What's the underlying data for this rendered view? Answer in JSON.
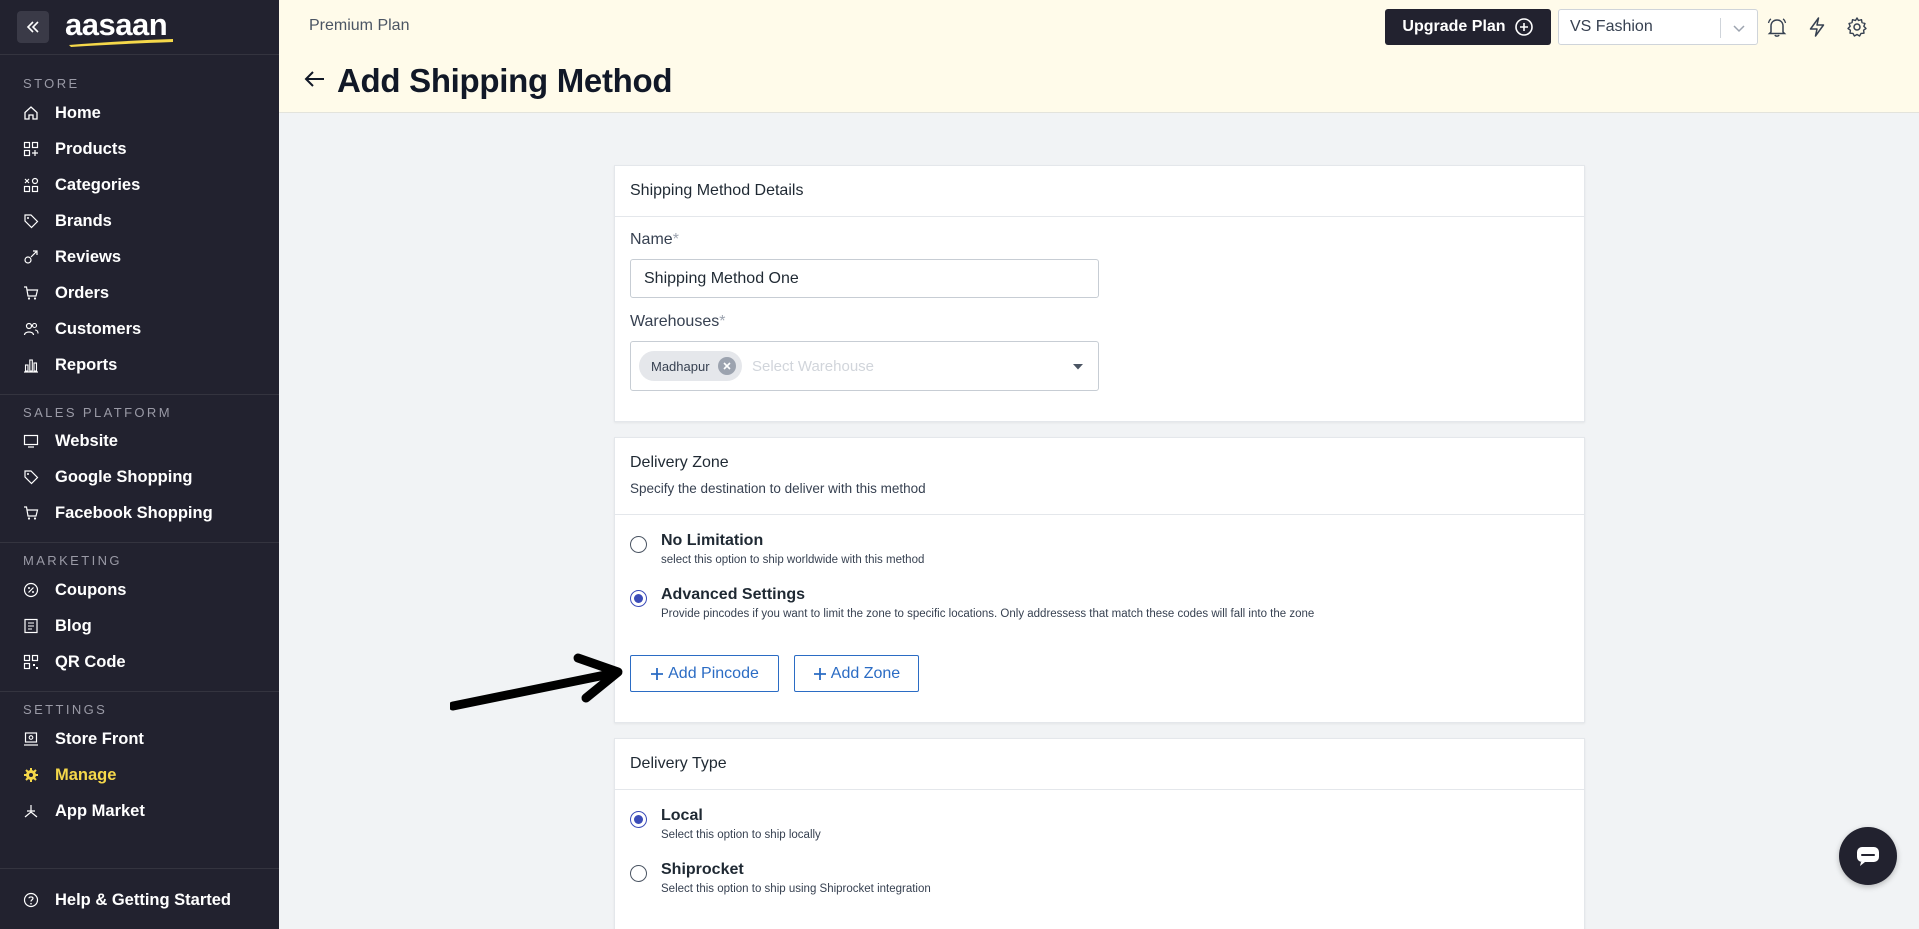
{
  "brand": {
    "logo_text": "aasaan",
    "accent": "#f5d84a",
    "sidebar_bg": "#22222f"
  },
  "sidebar": {
    "sections": {
      "store": "STORE",
      "sales_platform": "SALES PLATFORM",
      "marketing": "MARKETING",
      "settings": "SETTINGS"
    },
    "items": [
      {
        "label": "Home",
        "icon": "home-icon"
      },
      {
        "label": "Products",
        "icon": "grid-icon"
      },
      {
        "label": "Categories",
        "icon": "categories-icon"
      },
      {
        "label": "Brands",
        "icon": "tag-icon"
      },
      {
        "label": "Reviews",
        "icon": "reviews-icon"
      },
      {
        "label": "Orders",
        "icon": "cart-icon"
      },
      {
        "label": "Customers",
        "icon": "users-icon"
      },
      {
        "label": "Reports",
        "icon": "bar-chart-icon"
      },
      {
        "label": "Website",
        "icon": "monitor-icon"
      },
      {
        "label": "Google Shopping",
        "icon": "tag-icon"
      },
      {
        "label": "Facebook Shopping",
        "icon": "cart-icon"
      },
      {
        "label": "Coupons",
        "icon": "coupon-icon"
      },
      {
        "label": "Blog",
        "icon": "blog-icon"
      },
      {
        "label": "QR Code",
        "icon": "qr-code-icon"
      },
      {
        "label": "Store Front",
        "icon": "storefront-icon"
      },
      {
        "label": "Manage",
        "icon": "gear-icon",
        "active": true
      },
      {
        "label": "App Market",
        "icon": "app-market-icon"
      }
    ],
    "help": "Help & Getting Started"
  },
  "header": {
    "plan": "Premium Plan",
    "title": "Add Shipping Method",
    "upgrade_label": "Upgrade Plan",
    "store_name": "VS Fashion"
  },
  "details_card": {
    "title": "Shipping Method Details",
    "name_label": "Name",
    "name_value": "Shipping Method One",
    "warehouses_label": "Warehouses",
    "required_mark": "*",
    "warehouse_chip": "Madhapur",
    "warehouse_placeholder": "Select Warehouse"
  },
  "delivery_zone": {
    "title": "Delivery Zone",
    "subtitle": "Specify the destination to deliver with this method",
    "options": [
      {
        "title": "No Limitation",
        "desc": "select this option to ship worldwide with this method",
        "checked": false
      },
      {
        "title": "Advanced Settings",
        "desc": "Provide pincodes if you want to limit the zone to specific locations. Only addressess that match these codes will fall into the zone",
        "checked": true
      }
    ],
    "add_pincode": "Add Pincode",
    "add_zone": "Add Zone"
  },
  "delivery_type": {
    "title": "Delivery Type",
    "options": [
      {
        "title": "Local",
        "desc": "Select this option to ship locally",
        "checked": true
      },
      {
        "title": "Shiprocket",
        "desc": "Select this option to ship using Shiprocket integration",
        "checked": false
      }
    ]
  }
}
